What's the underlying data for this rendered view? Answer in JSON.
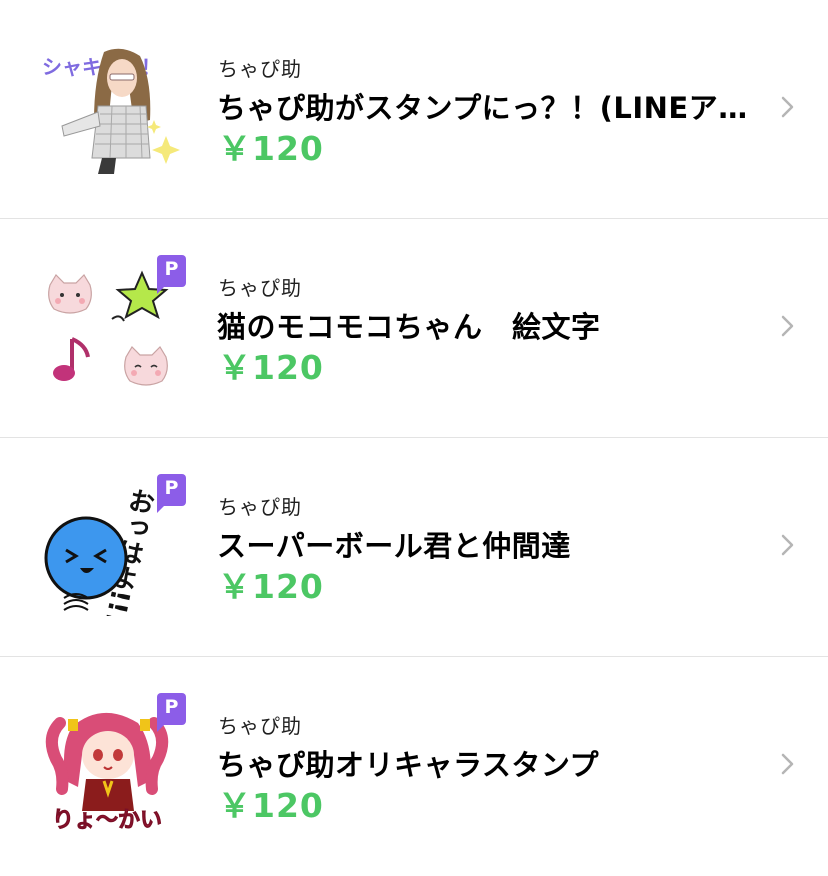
{
  "items": [
    {
      "author": "ちゃぴ助",
      "title": "ちゃぴ助がスタンプにっ？！(LINEア…",
      "price": "￥120",
      "premium": false,
      "thumb_icon": "girl-sticker-icon",
      "thumb_text": "シャキーン！"
    },
    {
      "author": "ちゃぴ助",
      "title": "猫のモコモコちゃん　絵文字",
      "price": "￥120",
      "premium": true,
      "badge": "P",
      "thumb_icon": "cat-emoji-icon"
    },
    {
      "author": "ちゃぴ助",
      "title": "スーパーボール君と仲間達",
      "price": "￥120",
      "premium": true,
      "badge": "P",
      "thumb_icon": "ball-character-icon",
      "thumb_text": "おっはよ!!!"
    },
    {
      "author": "ちゃぴ助",
      "title": "ちゃぴ助オリキャラスタンプ",
      "price": "￥120",
      "premium": true,
      "badge": "P",
      "thumb_icon": "anime-girl-icon",
      "thumb_text": "りょ〜かい"
    }
  ],
  "colors": {
    "price": "#4cc764",
    "badge": "#8c5de8",
    "divider": "#e3e3e3",
    "chevron": "#b5b5b5"
  },
  "chevron_icon": "chevron-right-icon"
}
